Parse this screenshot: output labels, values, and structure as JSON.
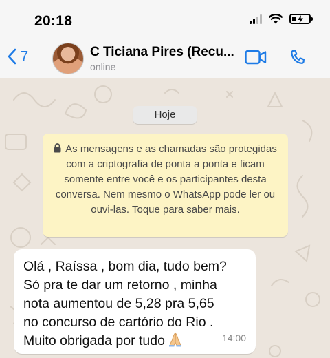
{
  "status_bar": {
    "time": "20:18"
  },
  "header": {
    "back_count": "7",
    "contact_name": "C Ticiana Pires (Recu...",
    "contact_status": "online"
  },
  "chat": {
    "date_label": "Hoje",
    "encryption_notice": "As mensagens e as chamadas são protegidas com a criptografia de ponta a ponta e ficam somente entre você e os participantes desta conversa. Nem mesmo o WhatsApp pode ler ou ouvi-las. Toque para saber mais.",
    "messages": [
      {
        "text": "Olá , Raíssa , bom dia, tudo bem?\nSó pra te dar um retorno , minha\nnota aumentou de 5,28 pra 5,65\nno concurso de cartório do Rio .\nMuito obrigada por tudo",
        "emoji": "praying-hands-icon",
        "time": "14:00"
      }
    ]
  },
  "colors": {
    "accent": "#1e7be6",
    "wallpaper": "#ece5dd",
    "notice_bg": "#fdf4c5",
    "bubble_bg": "#ffffff"
  }
}
